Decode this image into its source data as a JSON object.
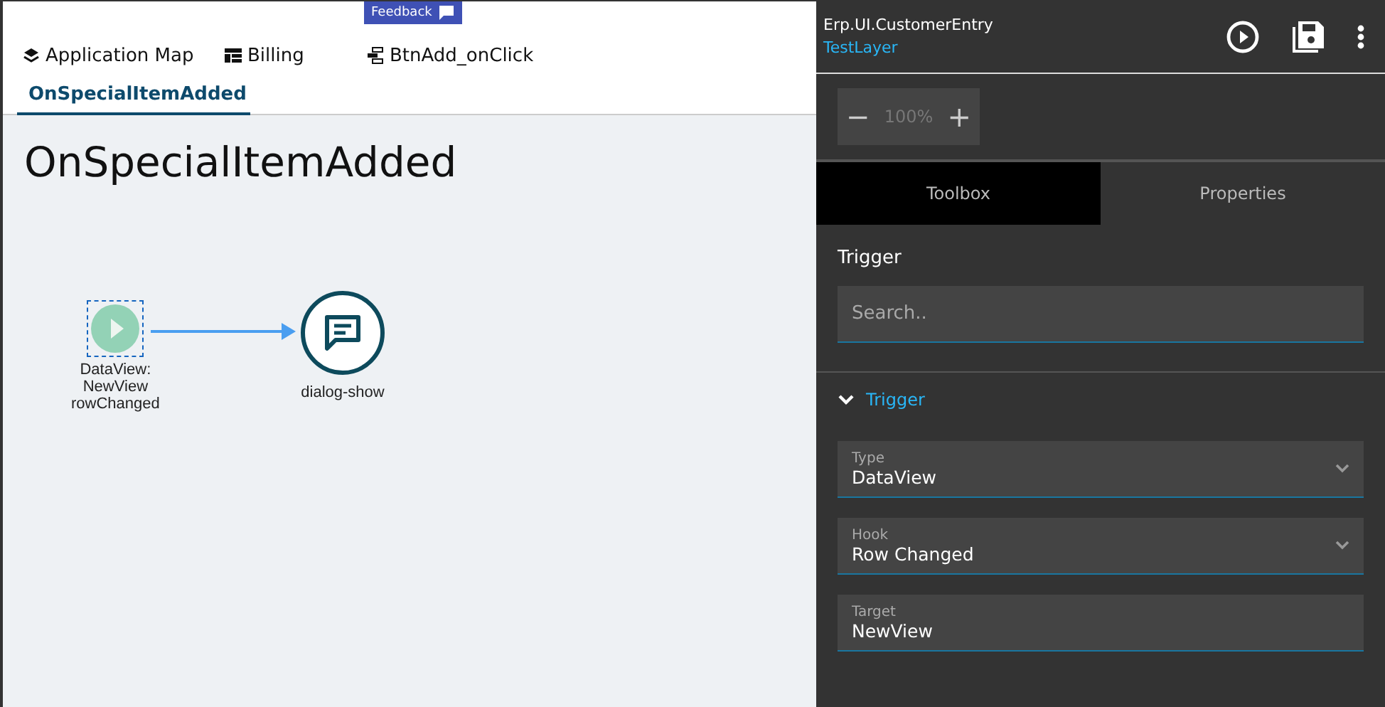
{
  "feedback": {
    "label": "Feedback"
  },
  "tabs": [
    {
      "label": "Application Map",
      "kind": "map",
      "selected": false
    },
    {
      "label": "Billing",
      "kind": "table",
      "selected": false
    },
    {
      "label": "BtnAdd_onClick",
      "kind": "flow",
      "selected": false
    },
    {
      "label": "OnSpecialItemAdded",
      "kind": "flow",
      "selected": true
    }
  ],
  "canvas": {
    "title": "OnSpecialItemAdded",
    "nodes": [
      {
        "kind": "trigger",
        "label": "DataView:\nNewView\nrowChanged",
        "selected": true
      },
      {
        "kind": "dialog",
        "label": "dialog-show",
        "selected": false
      }
    ]
  },
  "header": {
    "title": "Erp.UI.CustomerEntry",
    "layer": "TestLayer"
  },
  "zoom": {
    "reading": "100%",
    "minus": "−",
    "plus": "+"
  },
  "panel_tabs": [
    {
      "label": "Toolbox",
      "selected": true
    },
    {
      "label": "Properties",
      "selected": false
    }
  ],
  "toolbox": {
    "heading": "Trigger",
    "search": {
      "placeholder": "Search.."
    }
  },
  "section": {
    "title": "Trigger",
    "expanded": true,
    "fields": [
      {
        "kind": "select",
        "label": "Type",
        "value": "DataView"
      },
      {
        "kind": "select",
        "label": "Hook",
        "value": "Row Changed"
      },
      {
        "kind": "text",
        "label": "Target",
        "value": "NewView"
      }
    ]
  }
}
